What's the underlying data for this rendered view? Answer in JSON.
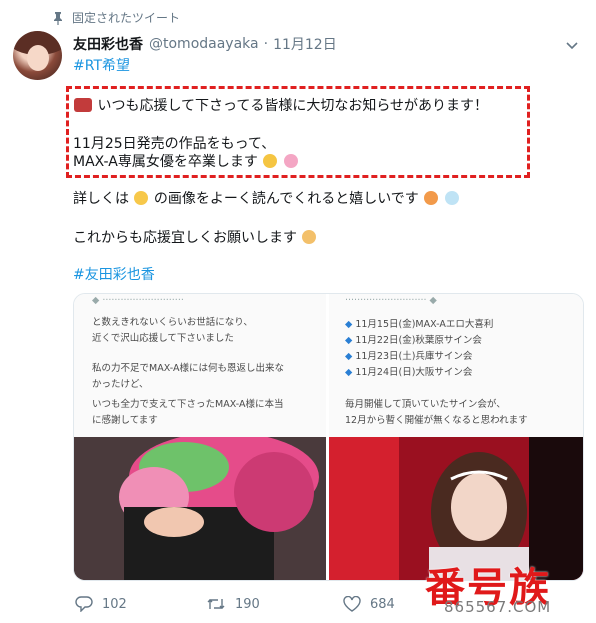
{
  "pinned_label": "固定されたツイート",
  "tweet": {
    "display_name": "友田彩也香",
    "handle": "@tomodaayaka",
    "separator": "·",
    "date": "11月12日",
    "hashtag_top": "#RT希望",
    "line1": "いつも応援して下さってる皆様に大切なお知らせがあります！",
    "line2": "11月25日発売の作品をもって、",
    "line3": "MAX-A専属女優を卒業します",
    "line4": "詳しくは",
    "line4b": "の画像をよーく読んでくれると嬉しいです",
    "line5": "これからも応援宜しくお願いします",
    "hashtag_bottom": "#友田彩也香"
  },
  "media": {
    "left_lines": [
      "と数えきれないくらいお世話になり、",
      "近くで沢山応援して下さいました",
      "私の力不足でMAX-A様には何も恩返し出来な",
      "かったけど、",
      "いつも全力で支えて下さったMAX-A様に本当",
      "に感謝してます"
    ],
    "right_events": [
      "11月15日(金)MAX-Aエロ大喜利",
      "11月22日(金)秋葉原サイン会",
      "11月23日(土)兵庫サイン会",
      "11月24日(日)大阪サイン会"
    ],
    "right_lines": [
      "毎月開催して頂いていたサイン会が、",
      "12月から暫く開催が無くなると思われます"
    ]
  },
  "actions": {
    "replies": "102",
    "retweets": "190",
    "likes": "684"
  },
  "watermark": {
    "text": "番号族",
    "url": "865567.COM"
  },
  "colors": {
    "link": "#1b95e0",
    "muted": "#657786",
    "highlight_border": "#e02020"
  }
}
